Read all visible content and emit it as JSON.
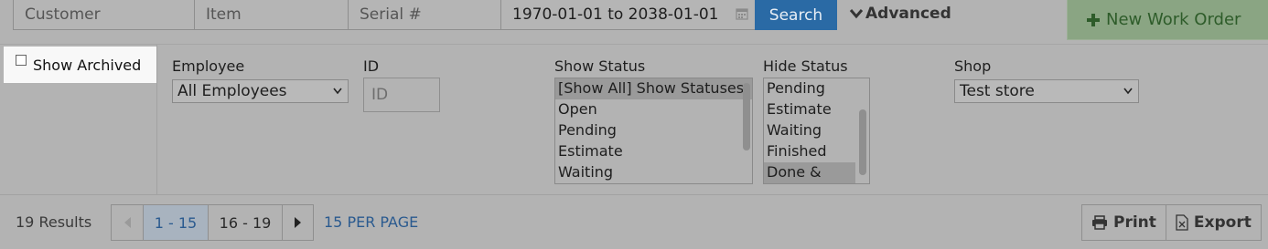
{
  "search": {
    "customer_placeholder": "Customer",
    "item_placeholder": "Item",
    "serial_placeholder": "Serial #",
    "date_range": "1970-01-01 to 2038-01-01",
    "search_label": "Search",
    "advanced_label": "Advanced",
    "new_work_order_label": "New Work Order"
  },
  "filters": {
    "show_archived_label": "Show Archived",
    "employee": {
      "label": "Employee",
      "selected": "All Employees"
    },
    "id": {
      "label": "ID",
      "placeholder": "ID"
    },
    "show_status": {
      "label": "Show Status",
      "options": [
        "[Show All] Show Statuses",
        "Open",
        "Pending",
        "Estimate",
        "Waiting"
      ]
    },
    "hide_status": {
      "label": "Hide Status",
      "options": [
        "Pending",
        "Estimate",
        "Waiting",
        "Finished",
        "Done & Paid"
      ]
    },
    "shop": {
      "label": "Shop",
      "selected": "Test store"
    }
  },
  "results": {
    "count_text": "19 Results",
    "pages": [
      "1 - 15",
      "16 - 19"
    ],
    "per_page_label": "15 PER PAGE",
    "print_label": "Print",
    "export_label": "Export"
  },
  "colors": {
    "accent": "#2a6aa5",
    "new_work_order_bg": "#8aa583",
    "new_work_order_text": "#2e5c2a",
    "link": "#2a5a8f"
  }
}
